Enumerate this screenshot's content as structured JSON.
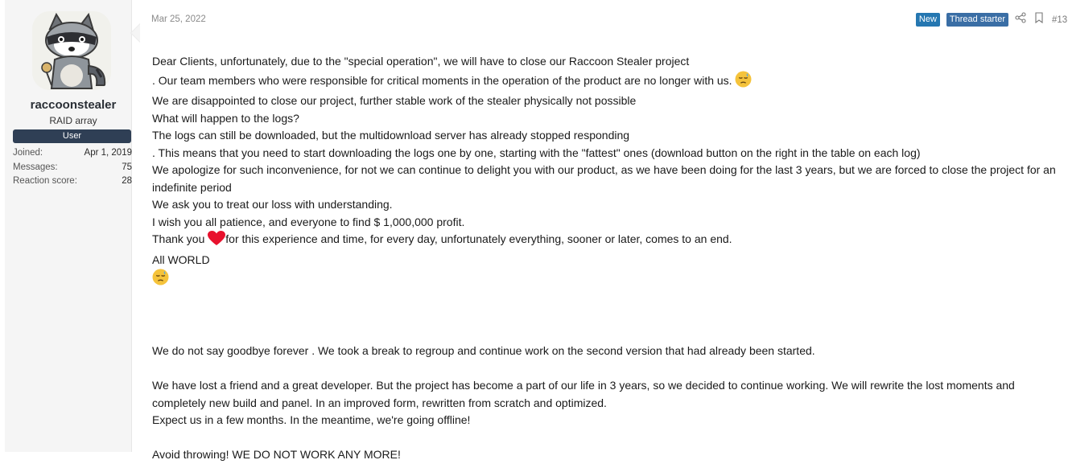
{
  "post": {
    "date": "Mar 25, 2022",
    "badges": {
      "new": "New",
      "thread_starter": "Thread starter"
    },
    "post_number": "#13",
    "icons": {
      "share": "share-icon",
      "bookmark": "bookmark-icon"
    },
    "colors": {
      "banner": "#2f3f55",
      "badge": "#2577b1",
      "heart": "#e8112d",
      "emoji": "#f5c33b"
    }
  },
  "user": {
    "name": "raccoonstealer",
    "title": "RAID array",
    "banner": "User",
    "stats": [
      {
        "label": "Joined:",
        "value": "Apr 1, 2019"
      },
      {
        "label": "Messages:",
        "value": "75"
      },
      {
        "label": "Reaction score:",
        "value": "28"
      }
    ]
  },
  "body": {
    "l1": "Dear Clients, unfortunately, due to the \"special operation\", we will have to close our Raccoon Stealer project",
    "l2": ". Our team members who were responsible for critical moments in the operation of the product are no longer with us.",
    "l3": "We are disappointed to close our project, further stable work of the stealer physically not possible",
    "l4": "What will happen to the logs?",
    "l5": "The logs can still be downloaded, but the multidownload server has already stopped responding",
    "l6": ". This means that you need to start downloading the logs one by one, starting with the \"fattest\" ones (download button on the right in the table on each log)",
    "l7": "We apologize for such inconvenience, for not we can continue to delight you with our product, as we have been doing for the last 3 years, but we are forced to close the project for an indefinite period",
    "l8": "We ask you to treat our loss with understanding.",
    "l9": "I wish you all patience, and everyone to find $ 1,000,000 profit.",
    "l10a": "Thank you",
    "l10b": "for this experience and time, for every day, unfortunately everything, sooner or later, comes to an end.",
    "l11": "All WORLD",
    "p2": "We do not say goodbye forever . We took a break to regroup and continue work on the second version that had already been started.",
    "p3a": "We have lost a friend and a great developer. But the project has become a part of our life in 3 years, so we decided to continue working. We will rewrite the lost moments and completely new build and panel. In an improved form, rewritten from scratch and optimized.",
    "p3b": "Expect us in a few months. In the meantime, we're going offline!",
    "p4": "Avoid throwing! WE DO NOT WORK ANY MORE!"
  }
}
